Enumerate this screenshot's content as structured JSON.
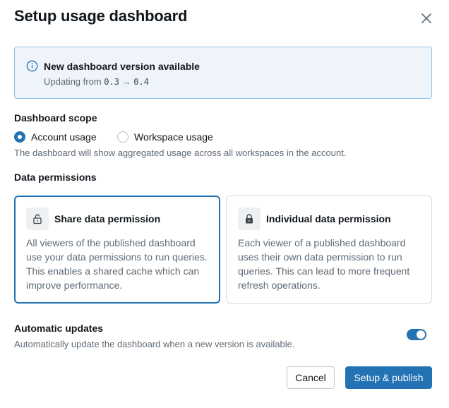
{
  "dialog": {
    "title": "Setup usage dashboard"
  },
  "banner": {
    "title": "New dashboard version available",
    "prefix": "Updating from",
    "from_version": "0.3",
    "arrow": "→",
    "to_version": "0.4",
    "accent": "#2272b4"
  },
  "scope": {
    "label": "Dashboard scope",
    "options": [
      {
        "label": "Account usage",
        "selected": true
      },
      {
        "label": "Workspace usage",
        "selected": false
      }
    ],
    "hint": "The dashboard will show aggregated usage across all workspaces in the account."
  },
  "permissions": {
    "label": "Data permissions",
    "cards": [
      {
        "title": "Share data permission",
        "icon": "lock-open-icon",
        "selected": true,
        "description": "All viewers of the published dashboard use your data permissions to run queries. This enables a shared cache which can improve performance."
      },
      {
        "title": "Individual data permission",
        "icon": "lock-icon",
        "selected": false,
        "description": "Each viewer of a published dashboard uses their own data permission to run queries. This can lead to more frequent refresh operations."
      }
    ]
  },
  "updates": {
    "label": "Automatic updates",
    "hint": "Automatically update the dashboard when a new version is available.",
    "enabled": true
  },
  "footer": {
    "cancel_label": "Cancel",
    "primary_label": "Setup & publish"
  }
}
